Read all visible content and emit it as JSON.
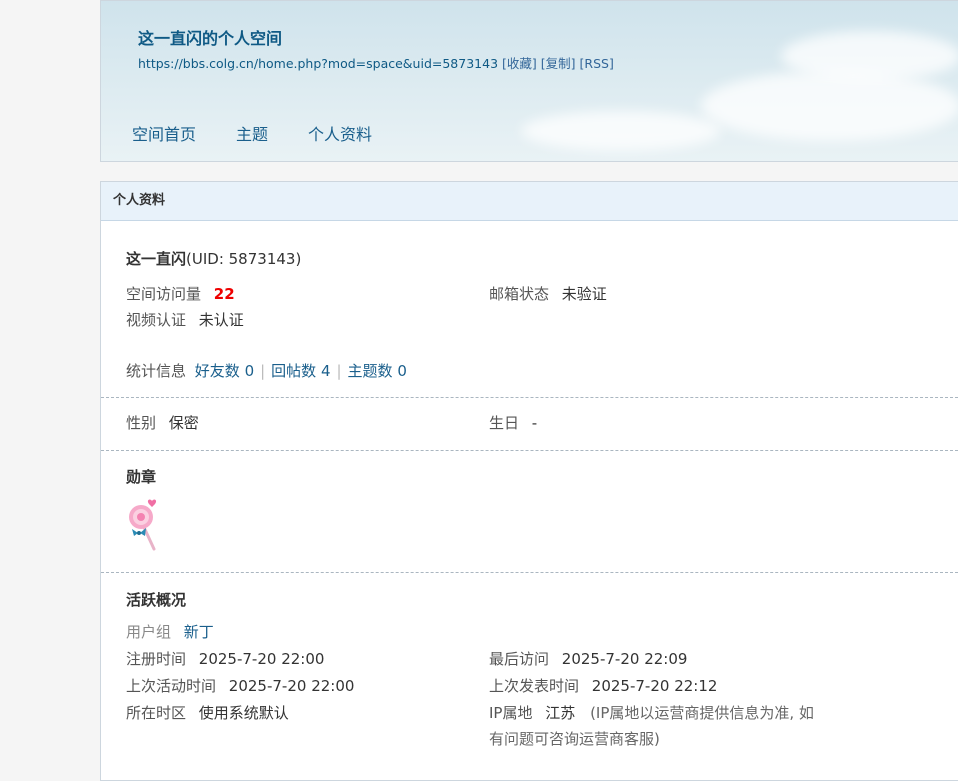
{
  "header": {
    "title": "这一直闪的个人空间",
    "url": "https://bbs.colg.cn/home.php?mod=space&uid=5873143",
    "links": [
      "[收藏]",
      "[复制]",
      "[RSS]"
    ],
    "nav": [
      "空间首页",
      "主题",
      "个人资料"
    ]
  },
  "panel": {
    "title": "个人资料",
    "username": "这一直闪",
    "uid_text": "(UID: 5873143)",
    "visits_label": "空间访问量",
    "visits_value": "22",
    "email_label": "邮箱状态",
    "email_value": "未验证",
    "video_label": "视频认证",
    "video_value": "未认证",
    "stats_label": "统计信息",
    "stats": [
      "好友数 0",
      "回帖数 4",
      "主题数 0"
    ],
    "gender_label": "性别",
    "gender_value": "保密",
    "birthday_label": "生日",
    "birthday_value": "-",
    "medals_heading": "勋章",
    "medal_icon": "lollipop-icon",
    "activity_heading": "活跃概况",
    "group_label": "用户组",
    "group_value": "新丁",
    "register_label": "注册时间",
    "register_value": "2025-7-20 22:00",
    "last_visit_label": "最后访问",
    "last_visit_value": "2025-7-20 22:09",
    "last_active_label": "上次活动时间",
    "last_active_value": "2025-7-20 22:00",
    "last_post_label": "上次发表时间",
    "last_post_value": "2025-7-20 22:12",
    "timezone_label": "所在时区",
    "timezone_value": "使用系统默认",
    "ip_label": "IP属地",
    "ip_value": "江苏",
    "ip_note_line1": "(IP属地以运营商提供信息为准, 如",
    "ip_note_line2": "有问题可咨询运营商客服)"
  },
  "colors": {
    "link": "#1a5f8c",
    "title": "#0f5a85",
    "visits": "#ee0000",
    "panel_header_bg": "#e8f2fa"
  }
}
